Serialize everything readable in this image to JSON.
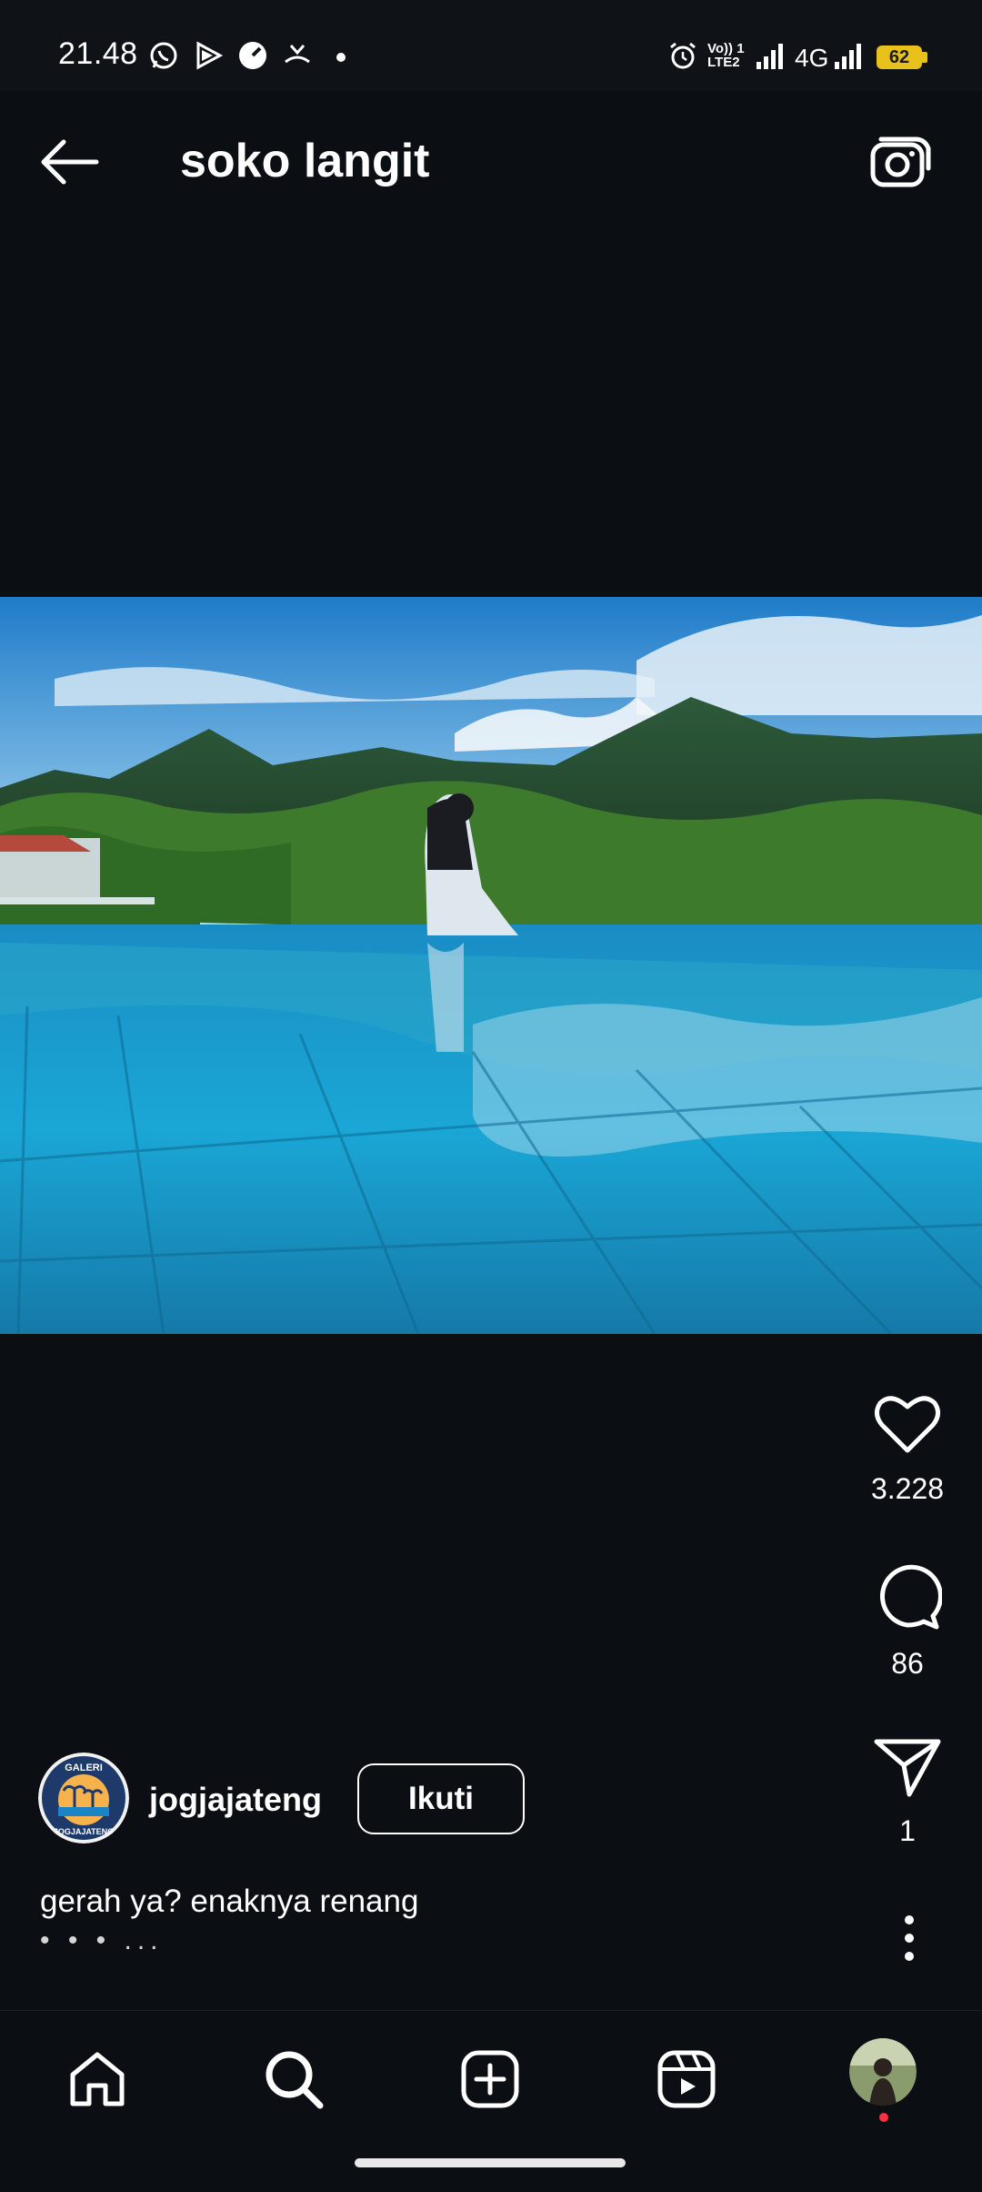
{
  "status_bar": {
    "time": "21.48",
    "carrier_label": "Vo)) 1 LTE2",
    "network_label": "4G",
    "battery": "62"
  },
  "header": {
    "title": "soko langit"
  },
  "post": {
    "likes": "3.228",
    "comments": "86",
    "shares": "1",
    "author": "jogjajateng",
    "avatar_text_top": "GALERI",
    "avatar_text_bottom": "JOGJAJATENG",
    "follow_label": "Ikuti",
    "caption": "gerah ya? enaknya renang",
    "caption_more": "• • • ..."
  },
  "nav": {
    "items": [
      "home",
      "search",
      "create",
      "reels",
      "profile"
    ]
  },
  "colors": {
    "background": "#0b0e13",
    "battery": "#e8c21a",
    "notification_dot": "#ff3040"
  }
}
